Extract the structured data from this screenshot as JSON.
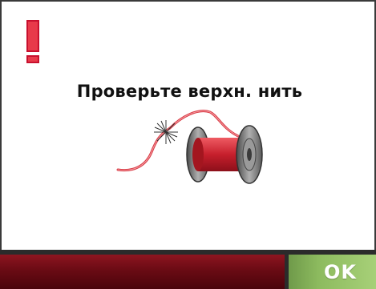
{
  "dialog": {
    "message": "Проверьте верхн. нить",
    "alert_icon": "exclamation-icon",
    "illustration_icon": "thread-spool-icon"
  },
  "actions": {
    "ok_label": "OK"
  },
  "colors": {
    "alert_red": "#c8102e",
    "status_strip": "#6a0b14",
    "ok_green": "#8dbb5f",
    "thread_red": "#d83a44",
    "spool_gray": "#8a8a8a"
  }
}
